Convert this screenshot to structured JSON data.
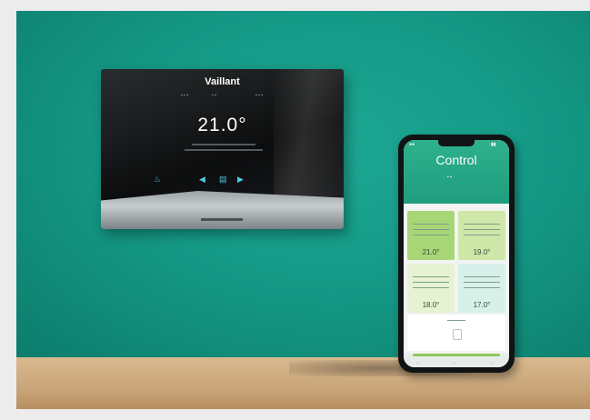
{
  "thermostat": {
    "brand": "Vaillant",
    "temperature": "21.0°"
  },
  "phone": {
    "app_title": "Control",
    "rooms": [
      {
        "value": "21.0°",
        "color": "#a8d677"
      },
      {
        "value": "19.0°",
        "color": "#cfe7a8"
      },
      {
        "value": "18.0°",
        "color": "#e7f2d3"
      },
      {
        "value": "17.0°",
        "color": "#d8f0ea"
      }
    ]
  }
}
